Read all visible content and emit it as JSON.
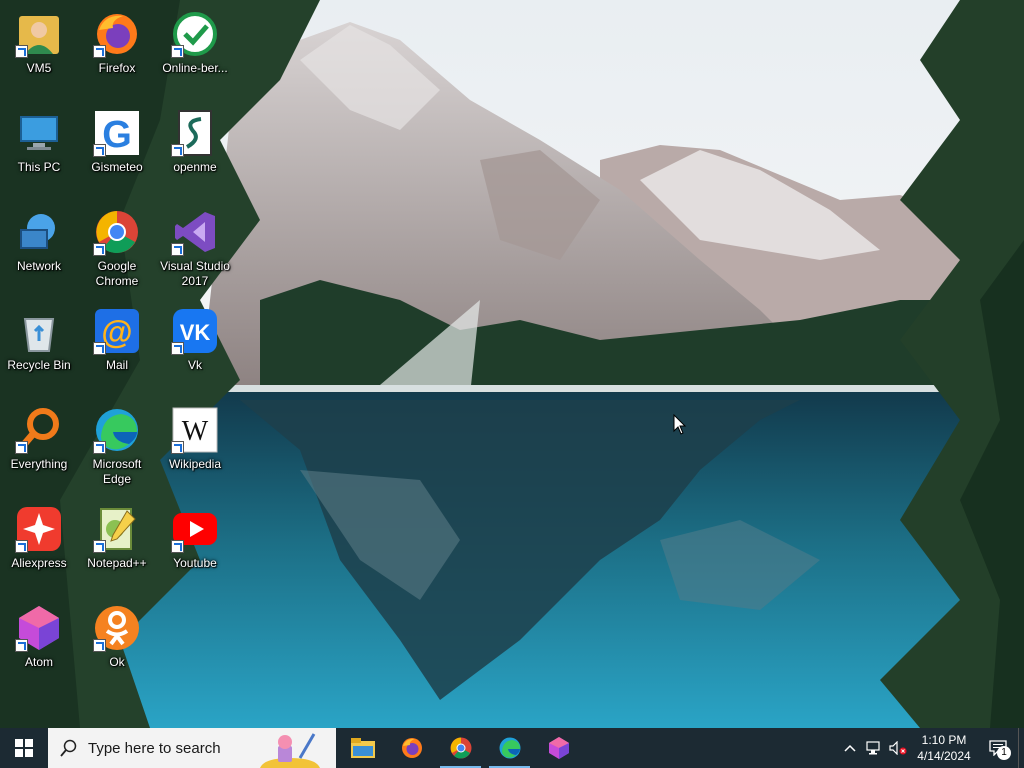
{
  "desktop_icons": [
    {
      "label": "VM5",
      "icon": "user-folder-icon"
    },
    {
      "label": "Firefox",
      "icon": "firefox-icon"
    },
    {
      "label": "Online-ber...",
      "icon": "check-circle-icon"
    },
    {
      "label": "This PC",
      "icon": "computer-icon"
    },
    {
      "label": "Gismeteo",
      "icon": "gismeteo-icon"
    },
    {
      "label": "openme",
      "icon": "script-file-icon"
    },
    {
      "label": "Network",
      "icon": "network-icon"
    },
    {
      "label": "Google Chrome",
      "icon": "chrome-icon"
    },
    {
      "label": "Visual Studio 2017",
      "icon": "visual-studio-icon"
    },
    {
      "label": "Recycle Bin",
      "icon": "recycle-bin-icon"
    },
    {
      "label": "Mail",
      "icon": "mail-icon"
    },
    {
      "label": "Vk",
      "icon": "vk-icon"
    },
    {
      "label": "Everything",
      "icon": "everything-search-icon"
    },
    {
      "label": "Microsoft Edge",
      "icon": "edge-icon"
    },
    {
      "label": "Wikipedia",
      "icon": "wikipedia-icon"
    },
    {
      "label": "Aliexpress",
      "icon": "aliexpress-icon"
    },
    {
      "label": "Notepad++",
      "icon": "notepadpp-icon"
    },
    {
      "label": "Youtube",
      "icon": "youtube-icon"
    },
    {
      "label": "Atom",
      "icon": "atom-icon"
    },
    {
      "label": "Ok",
      "icon": "odnoklassniki-icon"
    }
  ],
  "taskbar": {
    "search_placeholder": "Type here to search",
    "pinned_apps": [
      "file-explorer-icon",
      "firefox-icon",
      "chrome-icon",
      "edge-icon",
      "atom-icon"
    ],
    "clock_time": "1:10 PM",
    "clock_date": "4/14/2024",
    "notification_count": "1"
  },
  "colors": {
    "taskbar_bg": "#1c2a33",
    "search_bg": "#f3f3f3",
    "accent": "#76b9ed"
  }
}
